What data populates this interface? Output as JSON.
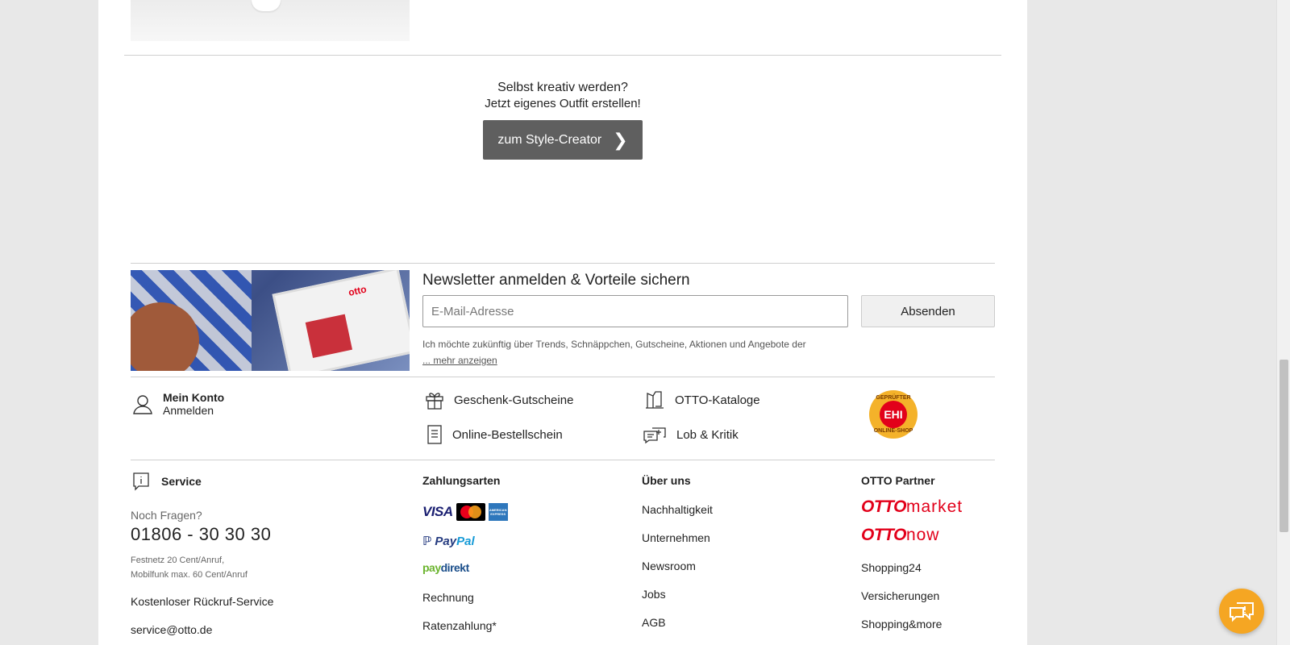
{
  "creator": {
    "line1": "Selbst kreativ werden?",
    "line2": "Jetzt eigenes Outfit erstellen!",
    "button": "zum Style-Creator"
  },
  "newsletter": {
    "title": "Newsletter anmelden & Vorteile sichern",
    "email_placeholder": "E-Mail-Adresse",
    "submit": "Absenden",
    "text": "Ich möchte zukünftig über Trends, Schnäppchen, Gutscheine, Aktionen und Angebote der",
    "more": "... mehr anzeigen"
  },
  "quicklinks": {
    "konto_title": "Mein Konto",
    "konto_sub": "Anmelden",
    "gutscheine": "Geschenk-Gutscheine",
    "kataloge": "OTTO-Kataloge",
    "bestellschein": "Online-Bestellschein",
    "kritik": "Lob & Kritik",
    "ehi_top": "GEPRÜFTER",
    "ehi_center": "EHI",
    "ehi_bottom": "ONLINE-SHOP"
  },
  "service": {
    "title": "Service",
    "question": "Noch Fragen?",
    "phone": "01806 - 30 30 30",
    "note1": "Festnetz 20 Cent/Anruf,",
    "note2": "Mobilfunk max. 60 Cent/Anruf",
    "callback": "Kostenloser Rückruf-Service",
    "email": "service@otto.de"
  },
  "payment": {
    "title": "Zahlungsarten",
    "visa": "VISA",
    "amex": "AMERICAN EXPRESS",
    "paypal_a": "Pay",
    "paypal_b": "Pal",
    "paydirekt_a": "pay",
    "paydirekt_b": "direkt",
    "rechnung": "Rechnung",
    "raten": "Ratenzahlung*"
  },
  "about": {
    "title": "Über uns",
    "items": [
      "Nachhaltigkeit",
      "Unternehmen",
      "Newsroom",
      "Jobs",
      "AGB"
    ]
  },
  "partner": {
    "title": "OTTO Partner",
    "market_a": "OTTO",
    "market_b": "market",
    "now_a": "OTTO",
    "now_b": "now",
    "items": [
      "Shopping24",
      "Versicherungen",
      "Shopping&more"
    ]
  },
  "colors": {
    "otto_red": "#e2001a",
    "button_dark": "#5f5f5f",
    "chat_orange": "#f5a623"
  }
}
